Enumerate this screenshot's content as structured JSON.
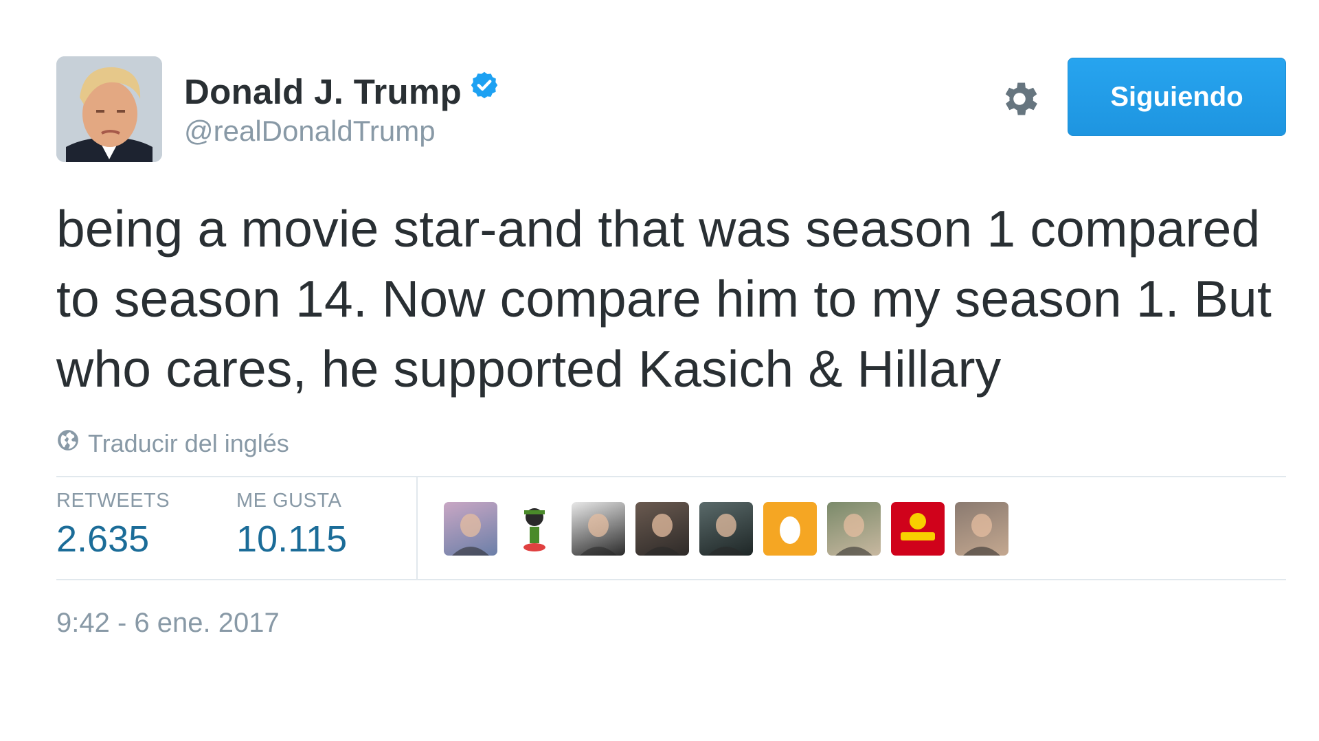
{
  "author": {
    "display_name": "Donald J. Trump",
    "screen_name": "@realDonaldTrump",
    "verified_color": "#1da1f2"
  },
  "follow_button": {
    "label": "Siguiendo",
    "color": "#1da1f2"
  },
  "icons": {
    "settings": "gear-icon",
    "verified": "verified-badge-icon",
    "translate": "globe-icon"
  },
  "tweet": {
    "text": "being a movie star-and that was season 1 compared to season 14. Now compare him to my season 1. But who cares, he supported Kasich & Hillary",
    "translate_label": "Traducir del inglés"
  },
  "stats": {
    "retweets_label": "RETWEETS",
    "retweets_value": "2.635",
    "likes_label": "ME GUSTA",
    "likes_value": "10.115"
  },
  "liker_avatars": [
    {
      "name": "liker-avatar-1",
      "colors": [
        "#c9a7c4",
        "#6b7fa8"
      ]
    },
    {
      "name": "liker-avatar-2",
      "colors": [
        "#ffffff",
        "#4a8a2a"
      ]
    },
    {
      "name": "liker-avatar-3",
      "colors": [
        "#e8e8e8",
        "#2a2a2a"
      ]
    },
    {
      "name": "liker-avatar-4",
      "colors": [
        "#6a5a50",
        "#2e2a28"
      ]
    },
    {
      "name": "liker-avatar-5",
      "colors": [
        "#5a6a6a",
        "#1e2626"
      ]
    },
    {
      "name": "liker-avatar-6",
      "colors": [
        "#f5a623",
        "#ffffff"
      ]
    },
    {
      "name": "liker-avatar-7",
      "colors": [
        "#7a8a6a",
        "#c8b8a0"
      ]
    },
    {
      "name": "liker-avatar-8",
      "colors": [
        "#d0021b",
        "#f8d000"
      ]
    },
    {
      "name": "liker-avatar-9",
      "colors": [
        "#8a7a70",
        "#c4a890"
      ]
    }
  ],
  "timestamp": "9:42 - 6 ene. 2017"
}
